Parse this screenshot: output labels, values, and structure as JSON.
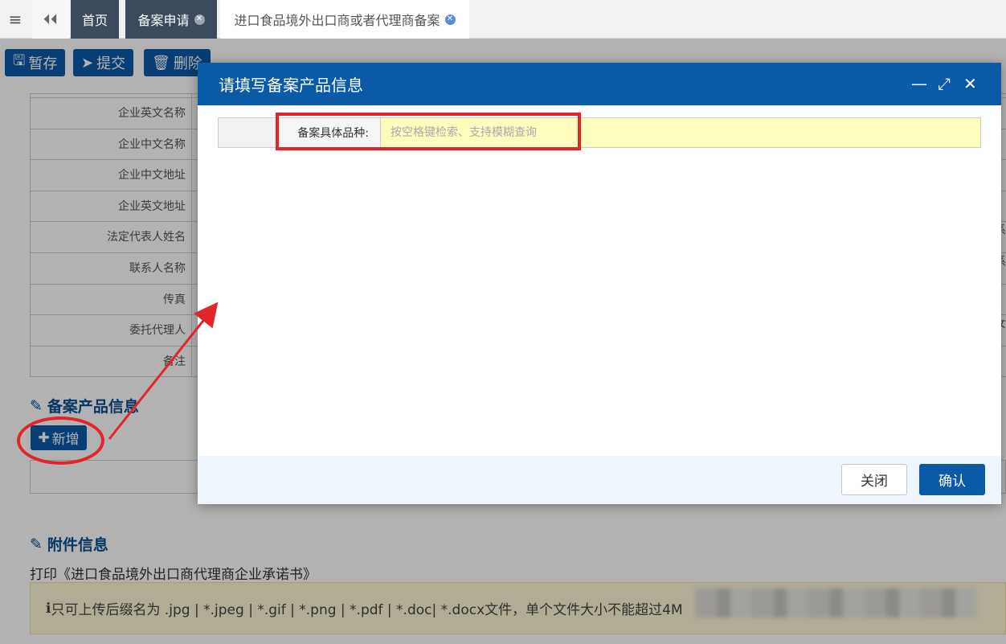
{
  "topbar": {
    "menu_icon": "menu-icon",
    "back_icon": "double-left-icon",
    "tabs": [
      {
        "label": "首页"
      },
      {
        "label": "备案申请"
      },
      {
        "label": "进口食品境外出口商或者代理商备案"
      }
    ]
  },
  "toolbar": {
    "save": "暂存",
    "submit": "提交",
    "delete": "删除"
  },
  "form": {
    "rows": [
      "",
      "企业英文名称",
      "企业中文名称",
      "企业中文地址",
      "企业英文地址",
      "法定代表人姓名",
      "联系人名称",
      "传真",
      "委托代理人",
      "备注"
    ],
    "right_cut": [
      "系",
      "系",
      "女"
    ]
  },
  "product_section": {
    "title": "备案产品信息",
    "add_button": "新增"
  },
  "attachment_section": {
    "title": "附件信息",
    "print_text": "打印《进口食品境外出口商代理商企业承诺书》",
    "notice": "只可上传后缀名为 .jpg | *.jpeg | *.gif | *.png | *.pdf | *.doc| *.docx文件，单个文件大小不能超过4M"
  },
  "modal": {
    "title": "请填写备案产品信息",
    "field_label": "备案具体品种:",
    "field_placeholder": "按空格键检索、支持模糊查询",
    "close": "关闭",
    "confirm": "确认"
  },
  "colors": {
    "primary": "#0a5aa8",
    "highlight": "#e0262b",
    "input_bg": "#fdfebe",
    "tab_dark": "#3b4b5c"
  }
}
